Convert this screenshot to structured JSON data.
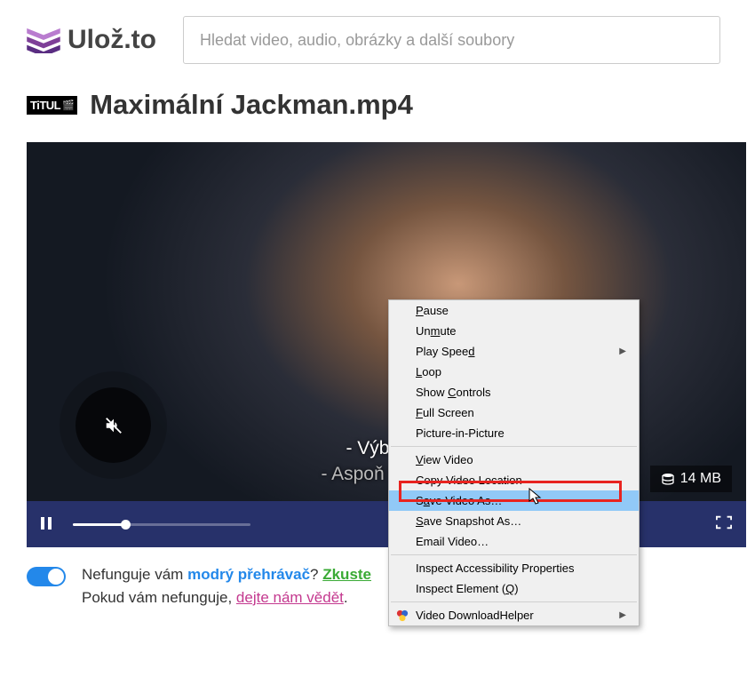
{
  "brand": {
    "name_bold": "Ulož",
    "name_rest": ".to"
  },
  "search": {
    "placeholder": "Hledat video, audio, obrázky a další soubory"
  },
  "badge": {
    "text": "TiTUL",
    "cam": "📹"
  },
  "file": {
    "title": "Maximální Jackman.mp4"
  },
  "subtitle": {
    "line1": "- Výborně",
    "line2": "- Aspoň to nebu"
  },
  "size": {
    "label": "14 MB"
  },
  "footer": {
    "q1": "Nefunguje vám ",
    "link_blue": "modrý přehrávač",
    "q2": "? ",
    "link_green": "Zkuste",
    "p2a": "Pokud vám nefunguje, ",
    "link_pink": "dejte nám vědět",
    "p2b": "."
  },
  "ctx": {
    "pause": "Pause",
    "unmute": "Unmute",
    "speed": "Play Speed",
    "loop": "Loop",
    "show_controls": "Show Controls",
    "fullscreen": "Full Screen",
    "pip": "Picture-in-Picture",
    "view": "View Video",
    "copy_loc": "Copy Video Location",
    "save_as": "Save Video As…",
    "snapshot": "Save Snapshot As…",
    "email": "Email Video…",
    "inspect_a11y": "Inspect Accessibility Properties",
    "inspect_el": "Inspect Element (Q)",
    "dlhelper": "Video DownloadHelper"
  }
}
